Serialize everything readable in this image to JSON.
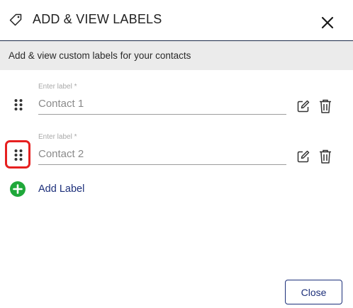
{
  "dialog": {
    "title": "ADD & VIEW LABELS",
    "title_icon": "tag-icon",
    "close_icon": "close-icon"
  },
  "subheader": {
    "text": "Add & view custom labels for your contacts"
  },
  "labels": [
    {
      "field_label": "Enter label *",
      "value": "Contact 1",
      "drag_icon": "drag-handle-icon",
      "edit_icon": "edit-icon",
      "delete_icon": "trash-icon",
      "highlighted": false
    },
    {
      "field_label": "Enter label *",
      "value": "Contact 2",
      "drag_icon": "drag-handle-icon",
      "edit_icon": "edit-icon",
      "delete_icon": "trash-icon",
      "highlighted": true
    }
  ],
  "add_label": {
    "text": "Add Label",
    "icon": "plus-circle-icon"
  },
  "footer": {
    "close_label": "Close"
  },
  "colors": {
    "accent": "#1c2f7a",
    "add_green": "#1fa83a",
    "highlight_red": "#e62020",
    "subheader_bg": "#ebebeb"
  }
}
